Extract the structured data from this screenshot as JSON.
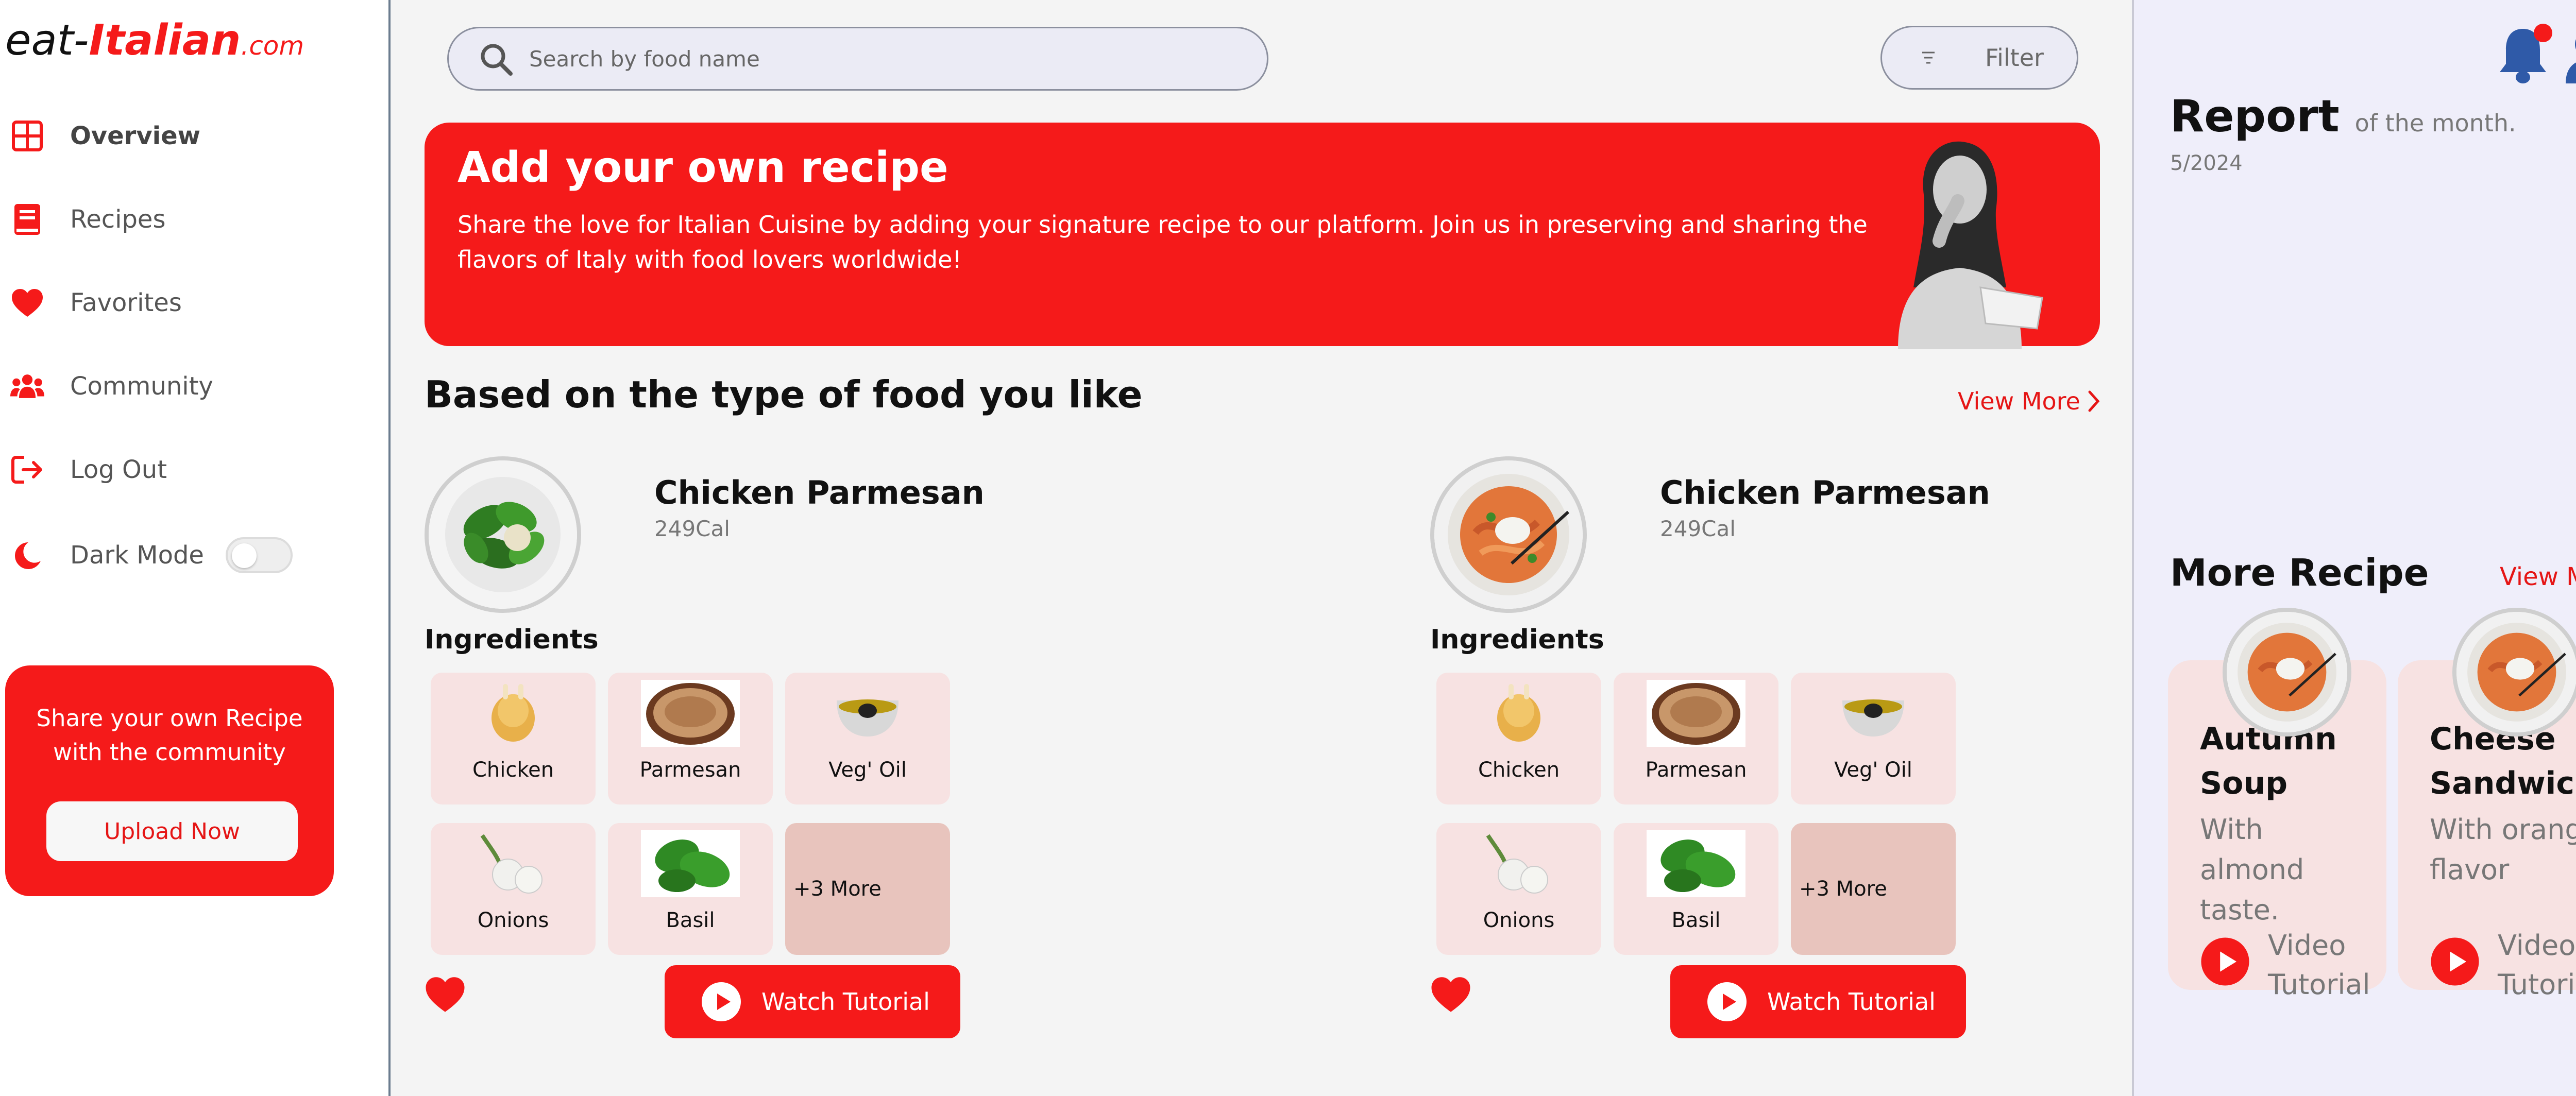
{
  "sidebar": {
    "logo": {
      "prefix": "eat-",
      "brand": "Italian",
      "suffix": ".com"
    },
    "items": [
      {
        "label": "Overview",
        "icon": "grid-icon"
      },
      {
        "label": "Recipes",
        "icon": "book-icon"
      },
      {
        "label": "Favorites",
        "icon": "heart-icon"
      },
      {
        "label": "Community",
        "icon": "users-icon"
      },
      {
        "label": "Log Out",
        "icon": "logout-icon"
      },
      {
        "label": "Dark Mode",
        "icon": "moon-icon"
      }
    ],
    "dark_mode_on": false,
    "share": {
      "text": "Share your own Recipe with the community",
      "button": "Upload Now"
    }
  },
  "search": {
    "placeholder": "Search by food name"
  },
  "filter": {
    "label": "Filter"
  },
  "banner": {
    "title": "Add your own recipe",
    "text": "Share the love for Italian Cuisine by adding your signature recipe to our platform. Join us in preserving and sharing the flavors of Italy with food lovers worldwide!"
  },
  "section": {
    "title": "Based on the type of food you like",
    "view_more": "View More"
  },
  "recipes": [
    {
      "name": "Chicken Parmesan",
      "calories": "249Cal",
      "ingredients_title": "Ingredients",
      "ingredients": [
        "Chicken",
        "Parmesan",
        "Veg' Oil",
        "Onions",
        "Basil"
      ],
      "more": "+3 More",
      "watch": "Watch Tutorial"
    },
    {
      "name": "Chicken Parmesan",
      "calories": "249Cal",
      "ingredients_title": "Ingredients",
      "ingredients": [
        "Chicken",
        "Parmesan",
        "Veg' Oil",
        "Onions",
        "Basil"
      ],
      "more": "+3 More",
      "watch": "Watch Tutorial"
    }
  ],
  "report": {
    "title": "Report",
    "subtitle": "of the month.",
    "date": "5/2024"
  },
  "more_recipes": {
    "title": "More Recipe",
    "view_more": "View More",
    "items": [
      {
        "name": "Autumn Soup",
        "desc": "With almond taste.",
        "video": "Video Tutorial"
      },
      {
        "name": "Cheese Sandwich",
        "desc": "With orange flavor",
        "video": "Video Tutorial"
      }
    ]
  },
  "colors": {
    "accent": "#f51a1a",
    "icon_blue": "#2f5aa8",
    "tile": "#f7e2e2",
    "right_bg": "#efeefa"
  }
}
